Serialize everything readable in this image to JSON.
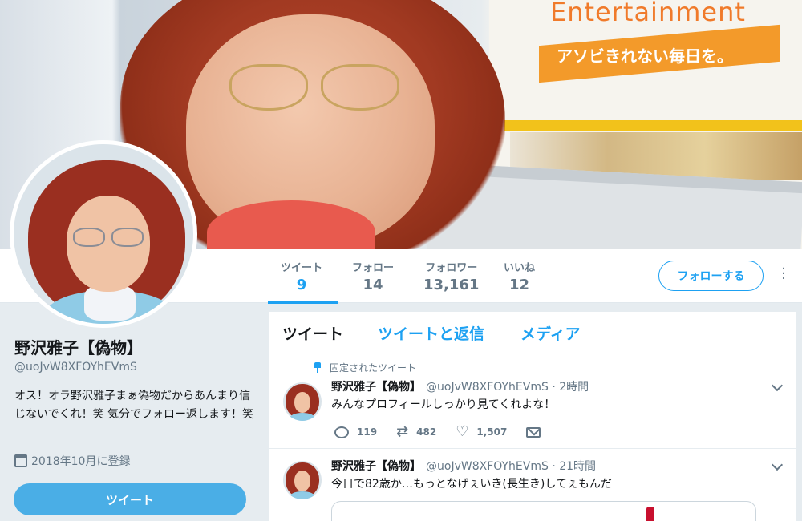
{
  "banner": {
    "sign_text": "Entertainment",
    "ribbon_text": "アソビきれない毎日を。"
  },
  "profile": {
    "display_name": "野沢雅子【偽物】",
    "handle": "@uoJvW8XFOYhEVmS",
    "bio": "オス！オラ野沢雅子まぁ偽物だからあんまり信じないでくれ！笑 気分でフォロー返します！笑",
    "joined": "2018年10月に登録",
    "tweet_button": "ツイート"
  },
  "stats": [
    {
      "label": "ツイート",
      "value": "9"
    },
    {
      "label": "フォロー",
      "value": "14"
    },
    {
      "label": "フォロワー",
      "value": "13,161"
    },
    {
      "label": "いいね",
      "value": "12"
    }
  ],
  "follow_button": "フォローする",
  "tabs": [
    "ツイート",
    "ツイートと返信",
    "メディア"
  ],
  "tweets": [
    {
      "pinned_label": "固定されたツイート",
      "name": "野沢雅子【偽物】",
      "meta": "@uoJvW8XFOYhEVmS · 2時間",
      "text": "みんなプロフィールしっかり見てくれよな！",
      "replies": "119",
      "retweets": "482",
      "likes": "1,507"
    },
    {
      "name": "野沢雅子【偽物】",
      "meta": "@uoJvW8XFOYhEVmS · 21時間",
      "text": "今日で82歳か…もっとなげぇいき(長生き)してぇもんだ"
    }
  ],
  "colors": {
    "accent": "#1da1f2",
    "background": "#e6ecf0",
    "tweet_button_bg": "#4aaee6",
    "muted_text": "#657786"
  }
}
